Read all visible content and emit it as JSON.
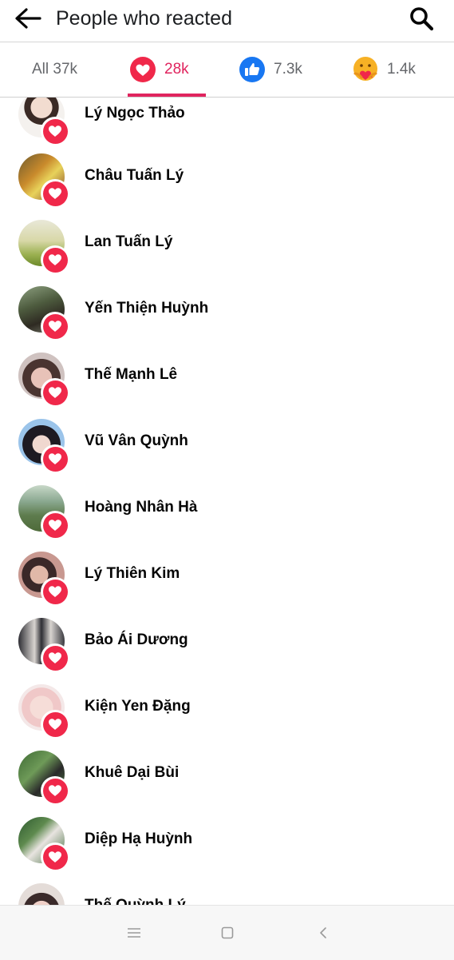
{
  "header": {
    "title": "People who reacted"
  },
  "tabs": [
    {
      "label": "All 37k"
    },
    {
      "label": "28k",
      "icon": "heart-icon"
    },
    {
      "label": "7.3k",
      "icon": "like-icon"
    },
    {
      "label": "1.4k",
      "icon": "care-icon"
    }
  ],
  "colors": {
    "accent": "#e0245e",
    "heart": "#f0284a",
    "like": "#1877f2",
    "care": "#f7b125"
  },
  "people": [
    {
      "name": "Lý Ngọc Thảo"
    },
    {
      "name": "Châu Tuấn Lý"
    },
    {
      "name": "Lan Tuấn Lý"
    },
    {
      "name": "Yến Thiện Huỳnh"
    },
    {
      "name": "Thế Mạnh Lê"
    },
    {
      "name": "Vũ Vân Quỳnh"
    },
    {
      "name": "Hoàng Nhân Hà"
    },
    {
      "name": "Lý Thiên Kim"
    },
    {
      "name": "Bảo Ái Dương"
    },
    {
      "name": "Kiện Yen Đặng"
    },
    {
      "name": "Khuê Dại Bùi"
    },
    {
      "name": "Diệp Hạ Huỳnh"
    },
    {
      "name": "Thế Quỳnh Lý"
    }
  ],
  "navbar": {
    "items": [
      "menu-icon",
      "home-icon",
      "back-icon"
    ]
  }
}
